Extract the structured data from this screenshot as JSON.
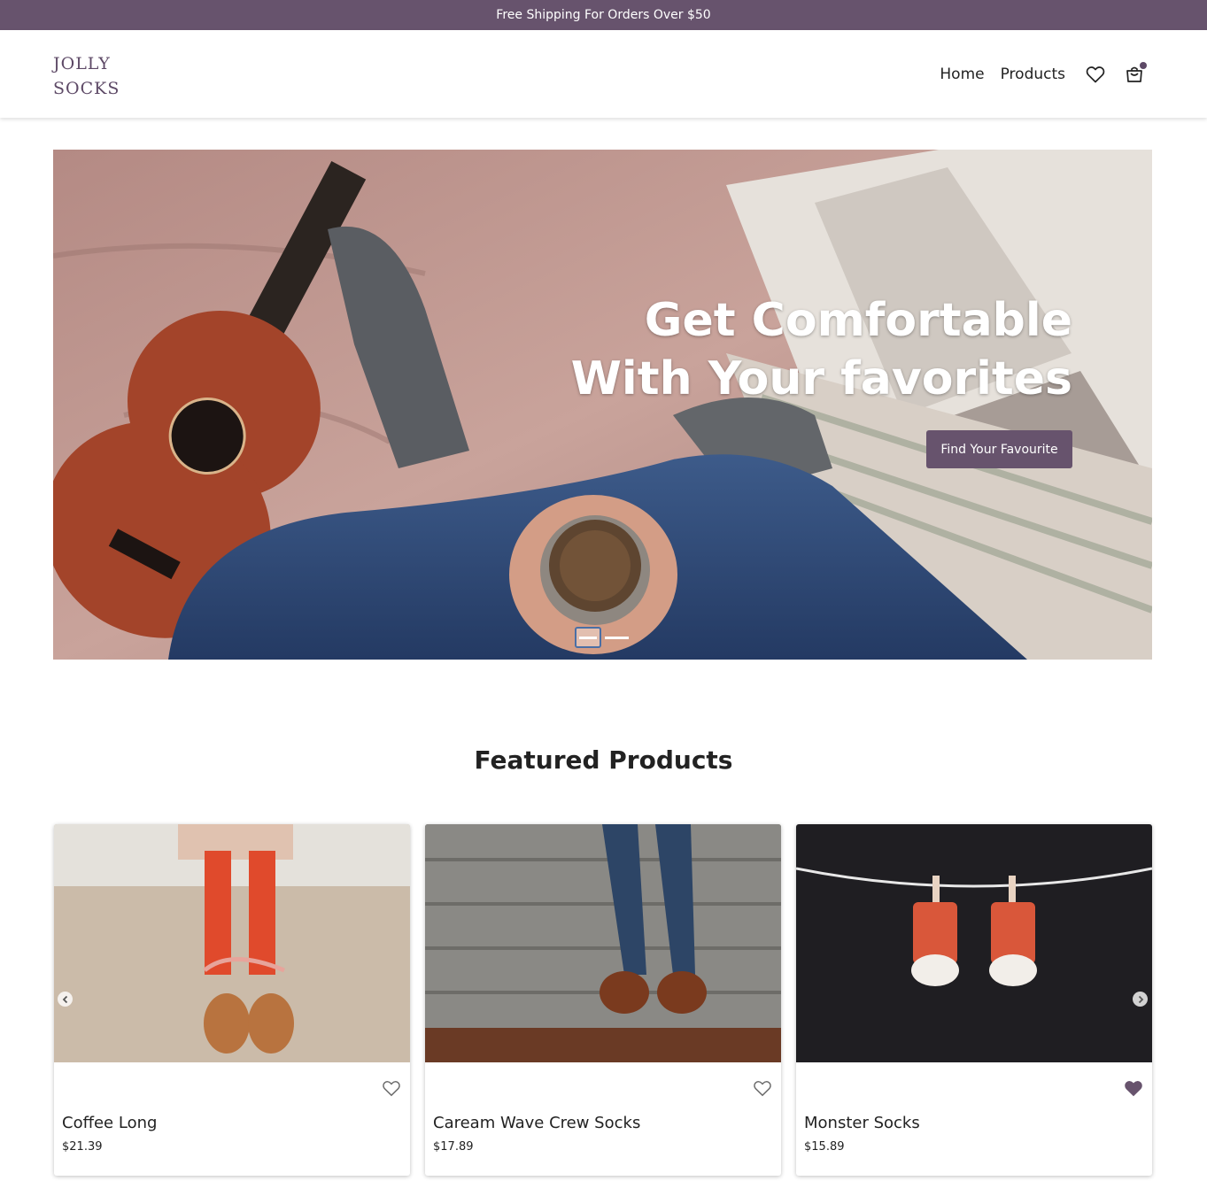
{
  "announcement": "Free Shipping For Orders Over $50",
  "brand": {
    "line1": "JOLLY",
    "line2": "SOCKS"
  },
  "nav": {
    "home": "Home",
    "products": "Products"
  },
  "hero": {
    "title_line1": "Get Comfortable",
    "title_line2": "With Your favorites",
    "cta": "Find Your Favourite"
  },
  "featured": {
    "title": "Featured Products",
    "products": [
      {
        "name": "Coffee Long",
        "price": "$21.39",
        "favorited": false
      },
      {
        "name": "Caream Wave Crew Socks",
        "price": "$17.89",
        "favorited": false
      },
      {
        "name": "Monster Socks",
        "price": "$15.89",
        "favorited": true
      }
    ]
  },
  "colors": {
    "brand": "#67536d",
    "text": "#222222"
  },
  "icons": [
    "heart-icon",
    "shopping-bag-icon",
    "chevron-left-icon",
    "chevron-right-icon"
  ]
}
